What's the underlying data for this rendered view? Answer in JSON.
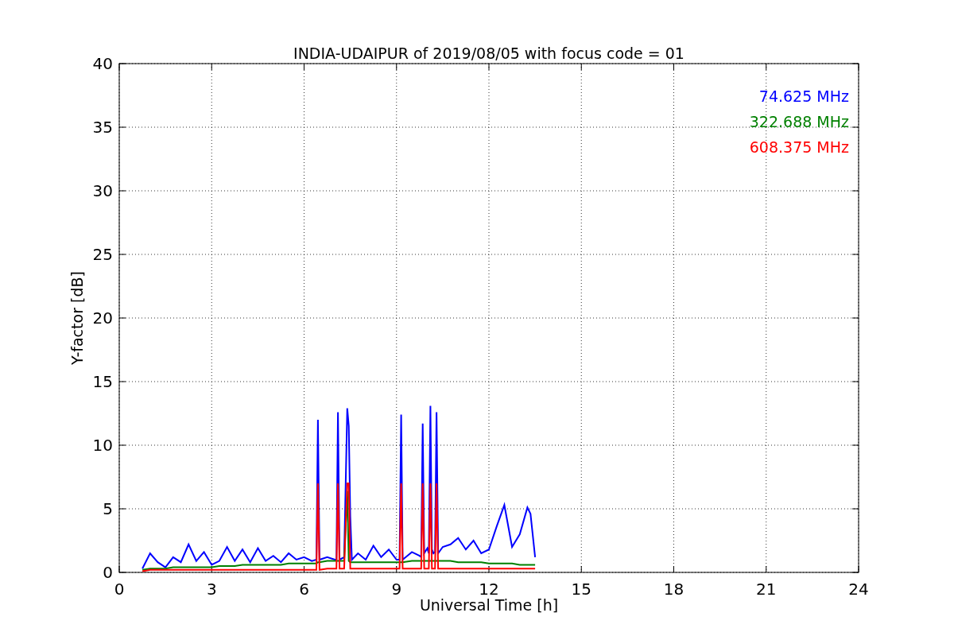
{
  "figure": {
    "chart_data": {
      "type": "line",
      "title": "INDIA-UDAIPUR of 2019/08/05 with focus code = 01",
      "xlabel": "Universal Time [h]",
      "ylabel": "Y-factor [dB]",
      "x": [
        0.75,
        1.0,
        1.25,
        1.5,
        1.75,
        2.0,
        2.25,
        2.5,
        2.75,
        3.0,
        3.25,
        3.5,
        3.75,
        4.0,
        4.25,
        4.5,
        4.75,
        5.0,
        5.25,
        5.5,
        5.75,
        6.0,
        6.25,
        6.4,
        6.45,
        6.5,
        6.75,
        7.0,
        7.05,
        7.1,
        7.15,
        7.3,
        7.4,
        7.45,
        7.5,
        7.55,
        7.75,
        8.0,
        8.25,
        8.5,
        8.75,
        9.0,
        9.1,
        9.15,
        9.2,
        9.5,
        9.75,
        9.8,
        9.85,
        9.9,
        10.0,
        10.05,
        10.1,
        10.15,
        10.2,
        10.25,
        10.3,
        10.35,
        10.5,
        10.75,
        11.0,
        11.25,
        11.5,
        11.75,
        12.0,
        12.25,
        12.5,
        12.75,
        13.0,
        13.25,
        13.35,
        13.5
      ],
      "series": [
        {
          "name": "74.625 MHz",
          "color": "#0000ff",
          "values": [
            0.3,
            1.5,
            0.8,
            0.4,
            1.2,
            0.8,
            2.2,
            0.9,
            1.6,
            0.6,
            0.9,
            2.0,
            0.9,
            1.8,
            0.8,
            1.9,
            0.9,
            1.3,
            0.8,
            1.5,
            1.0,
            1.2,
            0.9,
            1.0,
            12.0,
            1.0,
            1.2,
            1.0,
            1.0,
            12.6,
            1.0,
            1.2,
            12.9,
            11.5,
            4.4,
            1.0,
            1.5,
            1.0,
            2.1,
            1.2,
            1.8,
            1.0,
            1.0,
            12.4,
            1.0,
            1.6,
            1.3,
            1.2,
            11.7,
            1.5,
            1.9,
            1.5,
            13.1,
            1.8,
            1.5,
            1.6,
            12.6,
            1.5,
            2.0,
            2.2,
            2.7,
            1.8,
            2.5,
            1.5,
            1.8,
            3.6,
            5.3,
            2.0,
            3.0,
            5.1,
            4.6,
            1.2
          ]
        },
        {
          "name": "322.688 MHz",
          "color": "#008000",
          "values": [
            0.2,
            0.3,
            0.3,
            0.3,
            0.4,
            0.4,
            0.4,
            0.4,
            0.4,
            0.4,
            0.5,
            0.5,
            0.5,
            0.6,
            0.6,
            0.6,
            0.6,
            0.6,
            0.6,
            0.7,
            0.7,
            0.7,
            0.7,
            0.7,
            0.8,
            0.8,
            0.9,
            0.9,
            0.9,
            0.9,
            0.9,
            0.9,
            6.4,
            0.9,
            0.8,
            0.8,
            0.8,
            0.8,
            0.8,
            0.8,
            0.8,
            0.8,
            0.8,
            0.8,
            0.8,
            0.9,
            0.9,
            0.9,
            0.9,
            0.9,
            0.9,
            0.9,
            0.9,
            0.9,
            0.9,
            0.9,
            0.9,
            0.9,
            0.9,
            0.9,
            0.8,
            0.8,
            0.8,
            0.8,
            0.7,
            0.7,
            0.7,
            0.7,
            0.6,
            0.6,
            0.6,
            0.6
          ]
        },
        {
          "name": "608.375 MHz",
          "color": "#ff0000",
          "values": [
            0.1,
            0.2,
            0.2,
            0.2,
            0.2,
            0.2,
            0.2,
            0.2,
            0.2,
            0.2,
            0.2,
            0.2,
            0.2,
            0.2,
            0.2,
            0.2,
            0.2,
            0.2,
            0.2,
            0.2,
            0.2,
            0.2,
            0.2,
            0.2,
            7.0,
            0.2,
            0.3,
            0.3,
            0.3,
            7.0,
            0.3,
            0.3,
            7.0,
            7.0,
            0.3,
            0.3,
            0.3,
            0.3,
            0.3,
            0.3,
            0.3,
            0.3,
            0.3,
            7.0,
            0.3,
            0.3,
            0.3,
            0.3,
            7.0,
            0.3,
            0.3,
            0.3,
            7.0,
            0.3,
            0.3,
            0.3,
            7.0,
            0.3,
            0.3,
            0.3,
            0.3,
            0.3,
            0.3,
            0.3,
            0.3,
            0.3,
            0.3,
            0.3,
            0.3,
            0.3,
            0.3,
            0.3
          ]
        }
      ],
      "grid": true,
      "xlim": [
        0,
        24
      ],
      "ylim": [
        0,
        40
      ],
      "xticks": [
        0,
        3,
        6,
        9,
        12,
        15,
        18,
        21,
        24
      ],
      "yticks": [
        0,
        5,
        10,
        15,
        20,
        25,
        30,
        35,
        40
      ]
    }
  }
}
